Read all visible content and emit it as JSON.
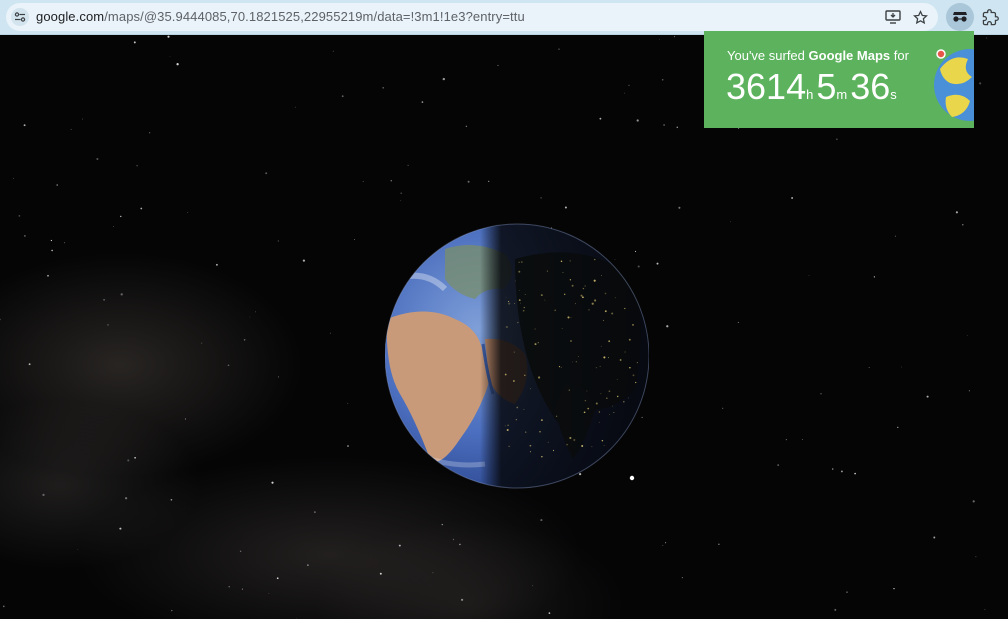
{
  "browser": {
    "url_domain": "google.com",
    "url_path": "/maps/@35.9444085,70.1821525,22955219m/data=!3m1!1e3?entry=ttu",
    "icons": [
      "site-info-icon",
      "install-app-icon",
      "bookmark-star-icon",
      "incognito-extension-icon",
      "extensions-puzzle-icon"
    ]
  },
  "popup": {
    "caption_prefix": "You've surfed ",
    "caption_brand": "Google Maps",
    "caption_suffix": " for",
    "hours": "3614",
    "hours_unit": "h",
    "minutes": "5",
    "minutes_unit": "m",
    "seconds": "36",
    "seconds_unit": "s",
    "background_color": "#5cb25d"
  },
  "map": {
    "view": "globe",
    "background": "space"
  }
}
